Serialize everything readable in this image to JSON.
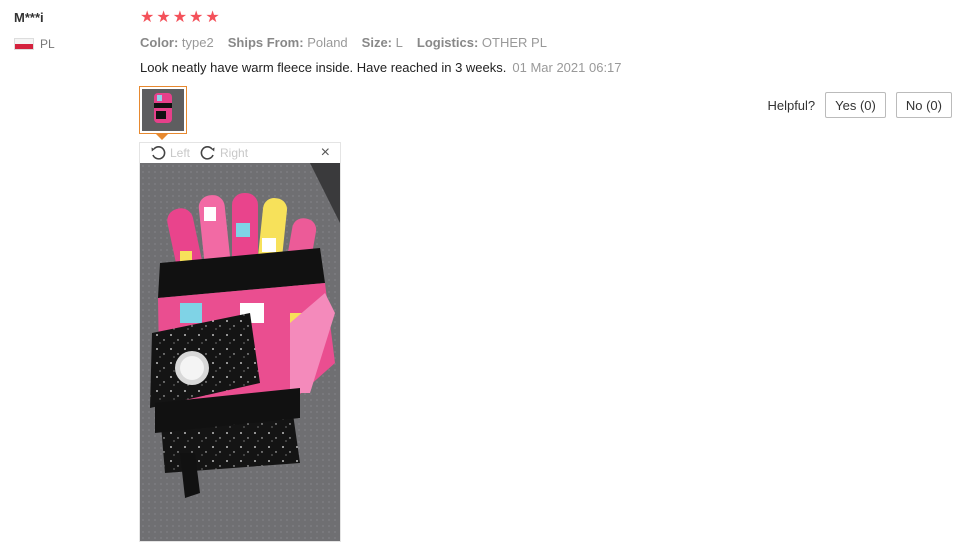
{
  "reviewer": {
    "name": "M***i",
    "country": "PL"
  },
  "rating": {
    "stars": 5,
    "star_glyph": "★",
    "star_color": "#f4515a"
  },
  "properties": [
    {
      "key": "Color:",
      "value": "type2"
    },
    {
      "key": "Ships From:",
      "value": "Poland"
    },
    {
      "key": "Size:",
      "value": "L"
    },
    {
      "key": "Logistics:",
      "value": "OTHER PL"
    }
  ],
  "review": {
    "text": "Look neatly have warm fleece inside. Have reached in 3 weeks.",
    "date": "01 Mar 2021 06:17"
  },
  "helpful": {
    "label": "Helpful?",
    "yes": "Yes (0)",
    "no": "No (0)"
  },
  "viewer": {
    "left_label": "Left",
    "right_label": "Right",
    "close_glyph": "×"
  },
  "icons": [
    "rotate-left-icon",
    "rotate-right-icon",
    "close-icon",
    "poland-flag-icon",
    "star-icon"
  ],
  "colors": {
    "accent": "#e7892f",
    "star": "#f4515a"
  }
}
